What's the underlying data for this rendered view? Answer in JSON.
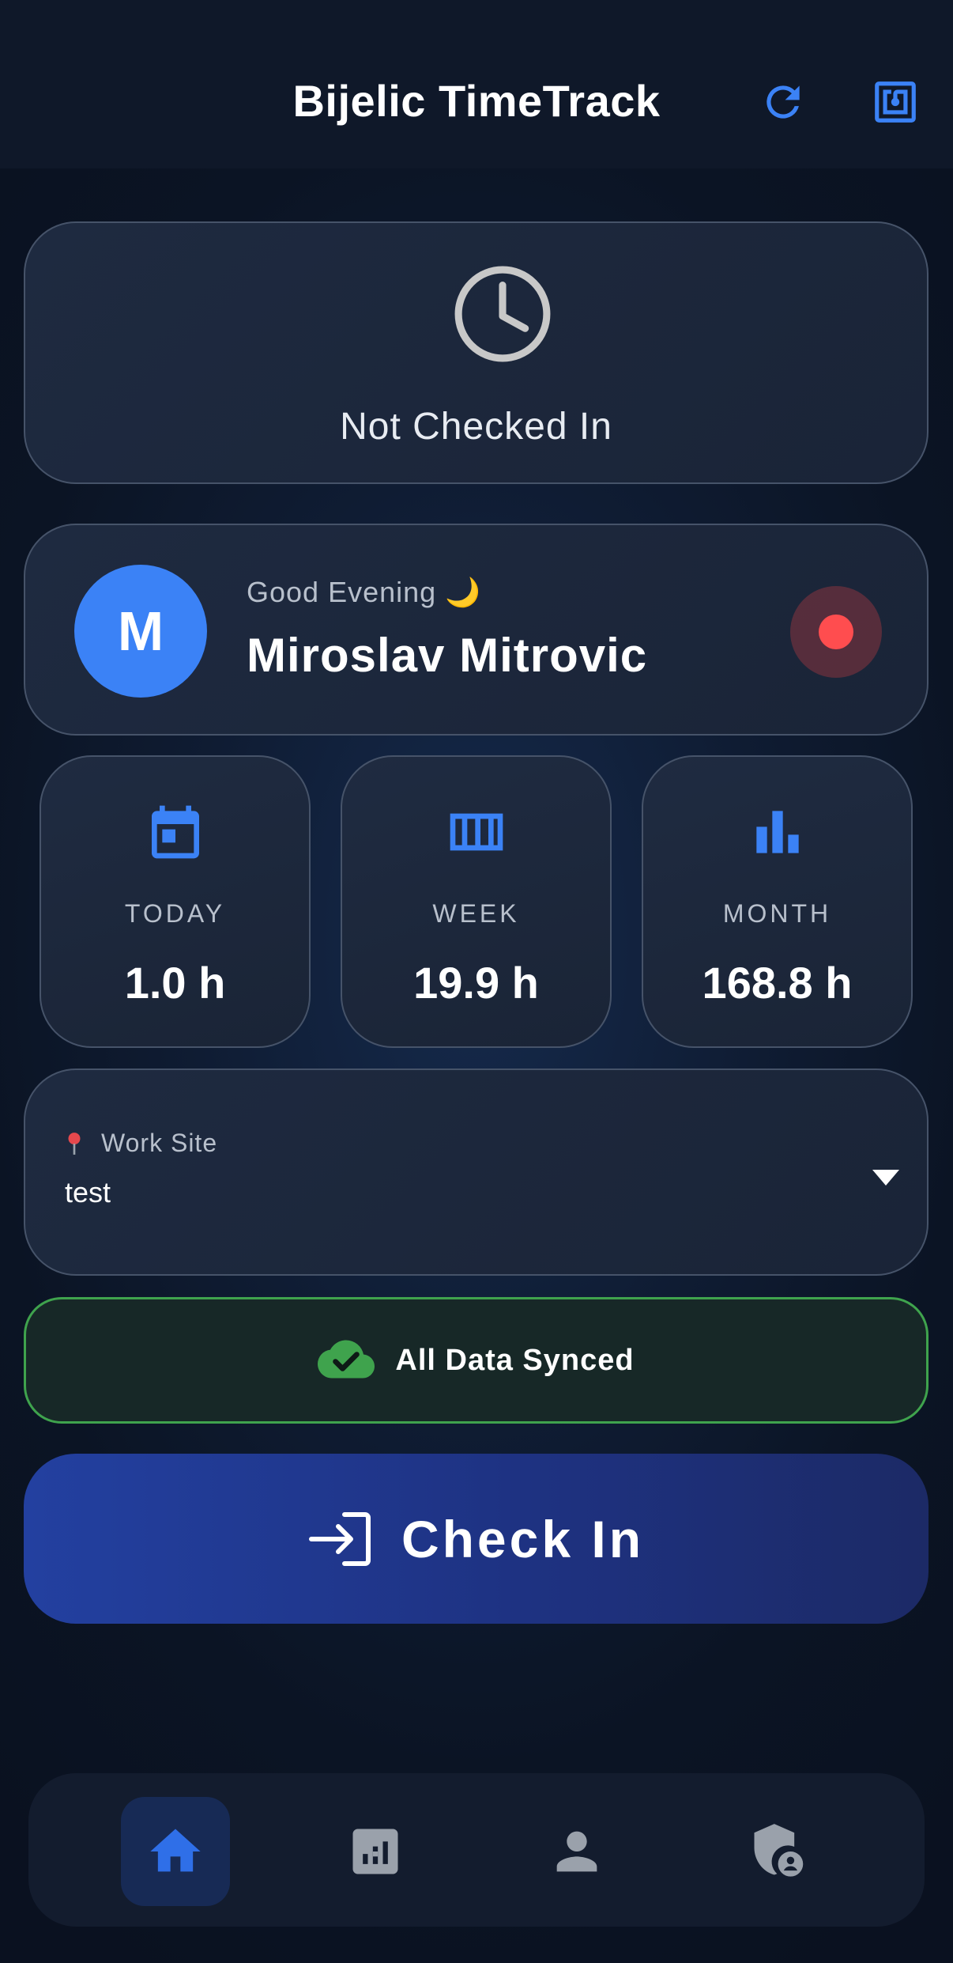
{
  "header": {
    "title": "Bijelic TimeTrack",
    "refresh_icon": "refresh-icon",
    "nfc_icon": "nfc-icon"
  },
  "status": {
    "icon": "clock-icon",
    "text": "Not Checked In"
  },
  "user": {
    "avatar_initial": "M",
    "greeting": "Good Evening 🌙",
    "name": "Miroslav Mitrovic",
    "status_color": "#ff4d4f"
  },
  "stats": [
    {
      "icon": "calendar-today-icon",
      "label": "TODAY",
      "value": "1.0 h"
    },
    {
      "icon": "calendar-week-icon",
      "label": "WEEK",
      "value": "19.9 h"
    },
    {
      "icon": "bar-chart-icon",
      "label": "MONTH",
      "value": "168.8 h"
    }
  ],
  "work_site": {
    "label": "Work Site",
    "icon": "pin-icon",
    "value": "test"
  },
  "sync": {
    "icon": "cloud-check-icon",
    "text": "All Data Synced",
    "color": "#3fa34d"
  },
  "checkin": {
    "icon": "login-icon",
    "label": "Check In"
  },
  "nav": [
    {
      "name": "home",
      "icon": "home-icon",
      "active": true
    },
    {
      "name": "statistics",
      "icon": "report-icon",
      "active": false
    },
    {
      "name": "profile",
      "icon": "person-icon",
      "active": false
    },
    {
      "name": "admin",
      "icon": "admin-shield-icon",
      "active": false
    }
  ],
  "colors": {
    "accent": "#3b82f6",
    "background": "#0f1c33",
    "card": "#1e2a40"
  }
}
